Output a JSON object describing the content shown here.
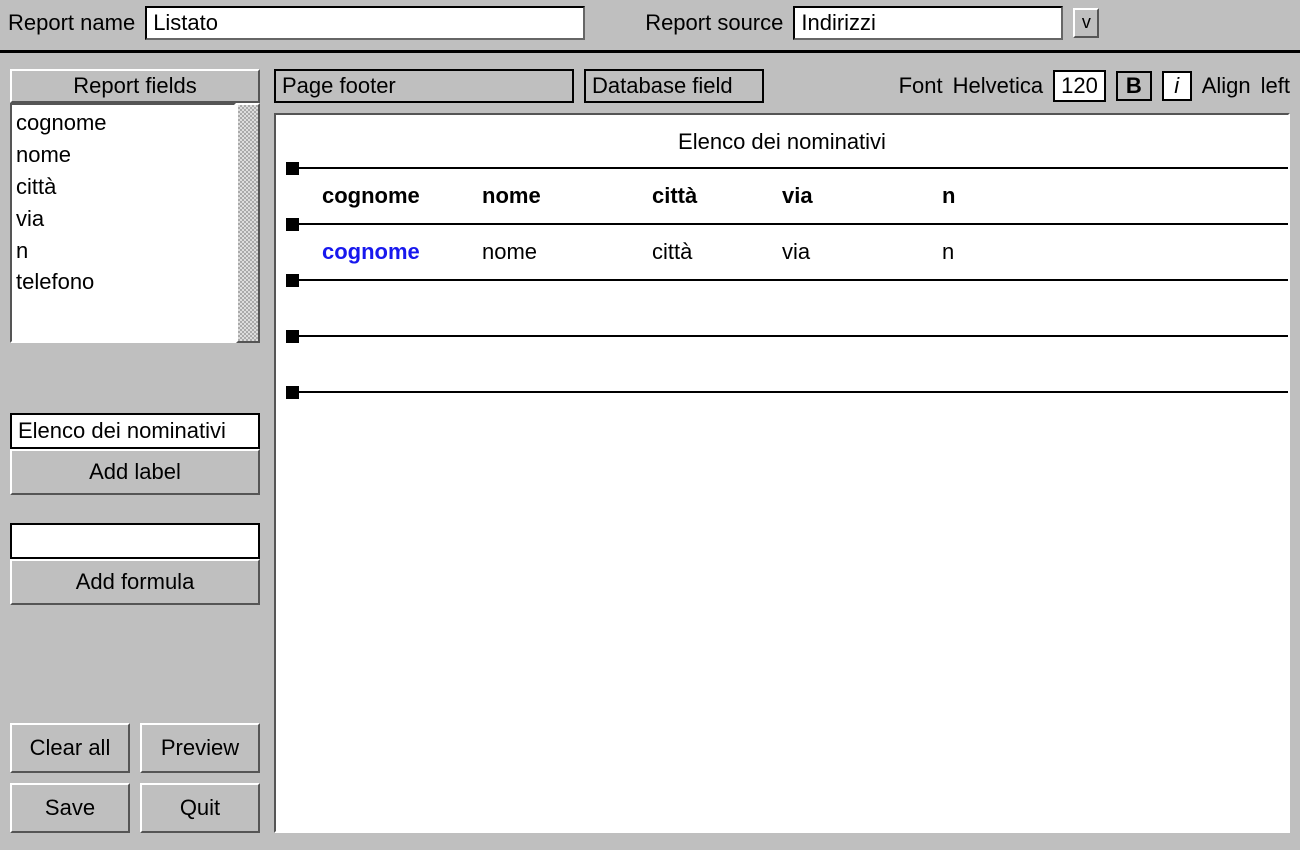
{
  "top": {
    "report_name_label": "Report name",
    "report_name_value": "Listato",
    "report_source_label": "Report source",
    "report_source_value": "Indirizzi",
    "dropdown_glyph": "v"
  },
  "left": {
    "fields_title": "Report fields",
    "fields": [
      "cognome",
      "nome",
      "città",
      "via",
      "n",
      "telefono"
    ],
    "label_input_value": "Elenco dei nominativi",
    "add_label_btn": "Add label",
    "formula_input_value": "",
    "add_formula_btn": "Add formula",
    "clear_all_btn": "Clear all",
    "preview_btn": "Preview",
    "save_btn": "Save",
    "quit_btn": "Quit"
  },
  "toolbar": {
    "section_selector": "Page footer",
    "field_type_selector": "Database field",
    "font_label": "Font",
    "font_value": "Helvetica",
    "font_size": "120",
    "bold_label": "B",
    "italic_label": "i",
    "align_label": "Align",
    "align_value": "left"
  },
  "canvas": {
    "title": "Elenco dei nominativi",
    "header_cols": [
      "cognome",
      "nome",
      "città",
      "via",
      "n"
    ],
    "data_cols": [
      "cognome",
      "nome",
      "città",
      "via",
      "n"
    ],
    "selected_data_col_index": 0
  }
}
